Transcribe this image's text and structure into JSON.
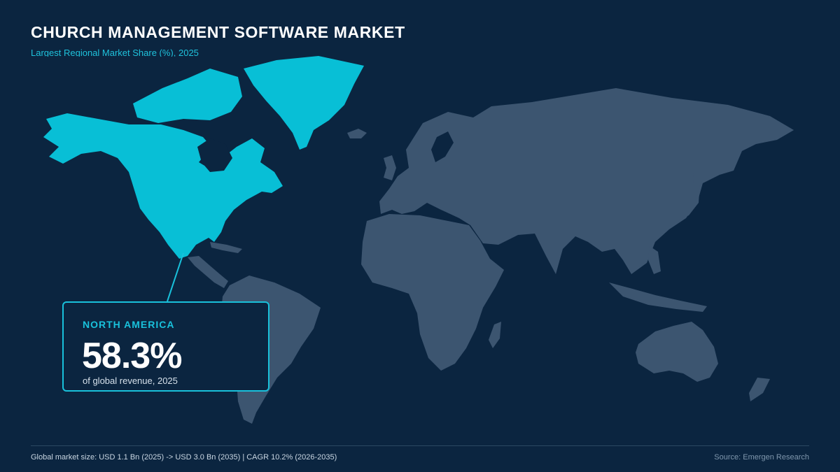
{
  "header": {
    "title": "CHURCH MANAGEMENT SOFTWARE MARKET",
    "subtitle": "Largest Regional Market Share (%), 2025"
  },
  "map": {
    "highlighted_region": "North America",
    "highlight_color": "#08bfd6",
    "land_color": "#3c5570",
    "background_color": "#0b2540"
  },
  "callout": {
    "region": "NORTH AMERICA",
    "value": "58.3%",
    "caption": "of global revenue, 2025"
  },
  "footer": {
    "market_note": "Global market size: USD 1.1 Bn (2025) -> USD 3.0 Bn (2035) | CAGR 10.2% (2026-2035)",
    "source": "Source: Emergen Research"
  }
}
